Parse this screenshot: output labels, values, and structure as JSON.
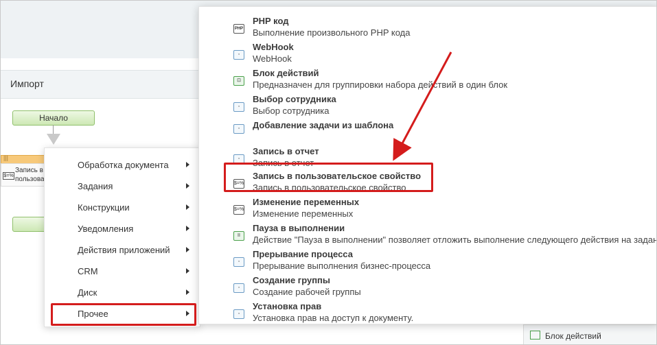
{
  "designer": {
    "import_label": "Импорт",
    "start_node": "Начало",
    "partial_node": {
      "icon_text": "$=%",
      "line1": "Запись в",
      "line2": "пользова"
    },
    "bottom_strip_label": "Блок действий"
  },
  "context_menu": {
    "items": [
      {
        "label": "Обработка документа"
      },
      {
        "label": "Задания"
      },
      {
        "label": "Конструкции"
      },
      {
        "label": "Уведомления"
      },
      {
        "label": "Действия приложений"
      },
      {
        "label": "CRM"
      },
      {
        "label": "Диск"
      },
      {
        "label": "Прочее"
      }
    ],
    "highlighted_index": 7
  },
  "submenu": {
    "items": [
      {
        "icon": "php-icon",
        "icon_text": "PHP",
        "title": "PHP код",
        "desc": "Выполнение произвольного PHP кода"
      },
      {
        "icon": "webhook-icon",
        "icon_text": "◦",
        "title": "WebHook",
        "desc": "WebHook"
      },
      {
        "icon": "block-icon",
        "icon_text": "⊡",
        "title": "Блок действий",
        "desc": "Предназначен для группировки набора действий в один блок"
      },
      {
        "icon": "employee-icon",
        "icon_text": "◦",
        "title": "Выбор сотрудника",
        "desc": "Выбор сотрудника"
      },
      {
        "icon": "task-template-icon",
        "icon_text": "◦",
        "title": "Добавление задачи из шаблона",
        "desc": ""
      },
      {
        "icon": "report-icon",
        "icon_text": "◦",
        "title": "Запись в отчет",
        "desc": "Запись в отчет"
      },
      {
        "icon": "variable-icon",
        "icon_text": "$=%",
        "title": "Запись в пользовательское свойство",
        "desc": "Запись в пользовательское свойство"
      },
      {
        "icon": "variable-icon",
        "icon_text": "$=%",
        "title": "Изменение переменных",
        "desc": "Изменение переменных"
      },
      {
        "icon": "pause-icon",
        "icon_text": "II",
        "title": "Пауза в выполнении",
        "desc": "Действие \"Пауза в выполнении\" позволяет отложить выполнение следующего действия на задан"
      },
      {
        "icon": "stop-icon",
        "icon_text": "◦",
        "title": "Прерывание процесса",
        "desc": "Прерывание выполнения бизнес-процесса"
      },
      {
        "icon": "group-icon",
        "icon_text": "◦",
        "title": "Создание группы",
        "desc": "Создание рабочей группы"
      },
      {
        "icon": "permissions-icon",
        "icon_text": "◦",
        "title": "Установка прав",
        "desc": "Установка прав на доступ к документу."
      }
    ],
    "highlighted_index": 6
  },
  "colors": {
    "highlight": "#d41c1c",
    "link_icon": "#6a9ac4",
    "green": "#4aa04a"
  }
}
